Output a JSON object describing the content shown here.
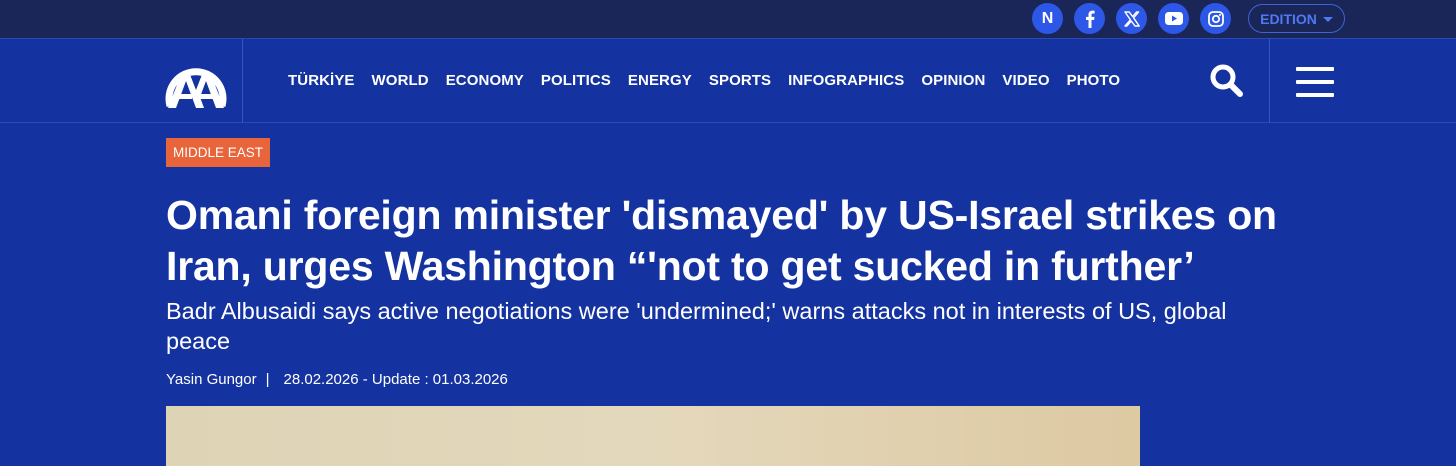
{
  "social": {
    "icons": [
      "news-icon",
      "facebook-icon",
      "x-twitter-icon",
      "youtube-icon",
      "instagram-icon"
    ],
    "news_letter": "N",
    "accent": "#2d57e6"
  },
  "edition": {
    "label": "EDITION"
  },
  "nav": {
    "items": [
      "TÜRKİYE",
      "WORLD",
      "ECONOMY",
      "POLITICS",
      "ENERGY",
      "SPORTS",
      "INFOGRAPHICS",
      "OPINION",
      "VIDEO",
      "PHOTO"
    ]
  },
  "article": {
    "category": "MIDDLE EAST",
    "category_color": "#e8643a",
    "headline": "Omani foreign minister 'dismayed' by US-Israel strikes on Iran, urges Washington “'not to get sucked in further’",
    "subtitle": "Badr Albusaidi says active negotiations were 'undermined;' warns attacks not in interests of US, global peace",
    "author": "Yasin Gungor",
    "separator": "|",
    "dates": "28.02.2026 - Update : 01.03.2026"
  },
  "colors": {
    "background": "#1533a0",
    "topbar": "#1a2658"
  }
}
